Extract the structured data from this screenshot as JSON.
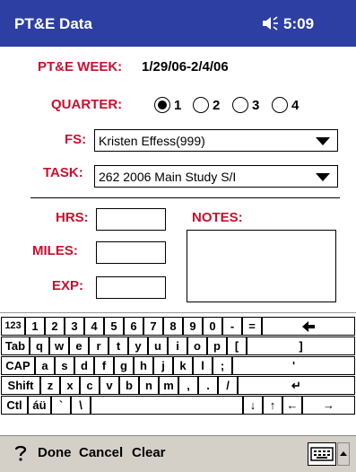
{
  "window": {
    "title": "PT&E Data",
    "time": "5:09",
    "volume_icon": "speaker-icon"
  },
  "form": {
    "week_label": "PT&E WEEK:",
    "week_value": "1/29/06-2/4/06",
    "quarter_label": "QUARTER:",
    "quarter_options": [
      "1",
      "2",
      "3",
      "4"
    ],
    "quarter_selected": "1",
    "fs_label": "FS:",
    "fs_value": "Kristen Effess(999)",
    "task_label": "TASK:",
    "task_value": "262 2006 Main Study S/I",
    "hrs_label": "HRS:",
    "miles_label": "MILES:",
    "exp_label": "EXP:",
    "notes_label": "NOTES:",
    "hrs_value": "",
    "miles_value": "",
    "exp_value": "",
    "notes_value": ""
  },
  "keyboard": {
    "rows": [
      [
        "123",
        "1",
        "2",
        "3",
        "4",
        "5",
        "6",
        "7",
        "8",
        "9",
        "0",
        "-",
        "=",
        "◆"
      ],
      [
        "Tab",
        "q",
        "w",
        "e",
        "r",
        "t",
        "y",
        "u",
        "i",
        "o",
        "p",
        "[",
        "]"
      ],
      [
        "CAP",
        "a",
        "s",
        "d",
        "f",
        "g",
        "h",
        "j",
        "k",
        "l",
        ";",
        "'"
      ],
      [
        "Shift",
        "z",
        "x",
        "c",
        "v",
        "b",
        "n",
        "m",
        ",",
        ".",
        "/",
        "↵"
      ],
      [
        "Ctl",
        "áü",
        "`",
        "\\",
        "",
        "↓",
        "↑",
        "←",
        "→"
      ]
    ]
  },
  "menubar": {
    "done": "Done",
    "cancel": "Cancel",
    "clear": "Clear",
    "help_icon": "help-icon",
    "keyboard_icon": "keyboard-icon"
  },
  "colors": {
    "titlebar": "#2d3fa3",
    "label": "#c8102e",
    "menubar": "#d4d0c8"
  }
}
